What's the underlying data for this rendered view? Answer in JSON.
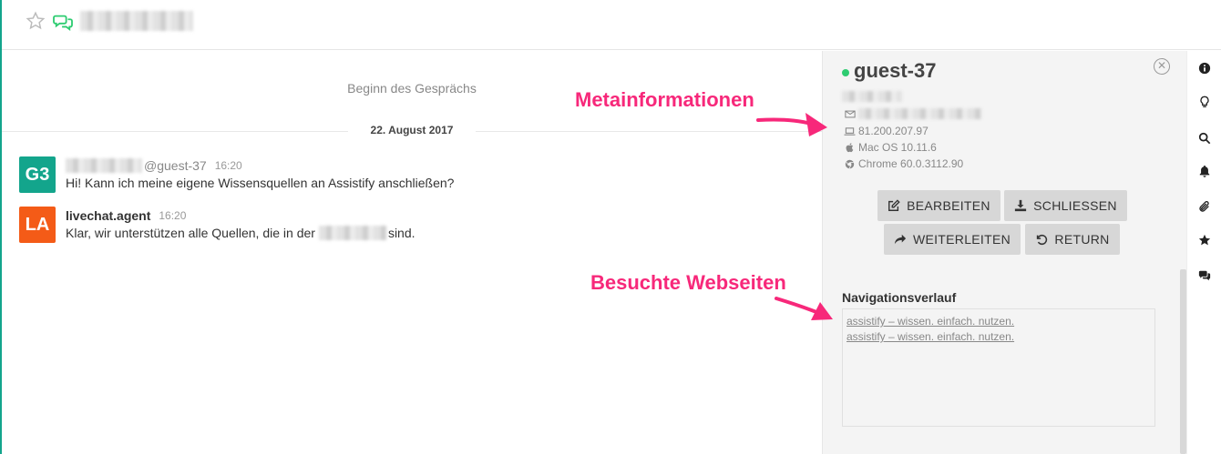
{
  "header": {
    "room_name_redacted": true
  },
  "chat": {
    "conversation_start": "Beginn des Gesprächs",
    "date": "22. August 2017",
    "messages": [
      {
        "avatar": "G3",
        "avatar_color": "#13a58c",
        "author": "",
        "username": "@guest-37",
        "time": "16:20",
        "text": "Hi! Kann ich meine eigene Wissensquellen an Assistify anschließen?"
      },
      {
        "avatar": "LA",
        "avatar_color": "#f45b17",
        "author": "livechat.agent",
        "username": "",
        "time": "16:20",
        "text_before": "Klar, wir unterstützen alle Quellen, die in der",
        "text_after": "sind."
      }
    ]
  },
  "panel": {
    "guest_name": "guest-37",
    "status_color": "#2ecc71",
    "ip": "81.200.207.97",
    "os": "Mac OS 10.11.6",
    "browser": "Chrome 60.0.3112.90",
    "buttons": {
      "edit": "BEARBEITEN",
      "close": "SCHLIESSEN",
      "forward": "WEITERLEITEN",
      "return": "RETURN"
    },
    "nav_title": "Navigationsverlauf",
    "nav_links": [
      "assistify – wissen. einfach. nutzen.",
      "assistify – wissen. einfach. nutzen."
    ]
  },
  "iconbar": {
    "icons": [
      "info-icon",
      "lightbulb-icon",
      "search-icon",
      "bell-icon",
      "paperclip-icon",
      "star-icon",
      "comments-icon"
    ]
  },
  "annotations": {
    "meta": "Metainformationen",
    "visited": "Besuchte Webseiten",
    "color": "#f7287a"
  }
}
